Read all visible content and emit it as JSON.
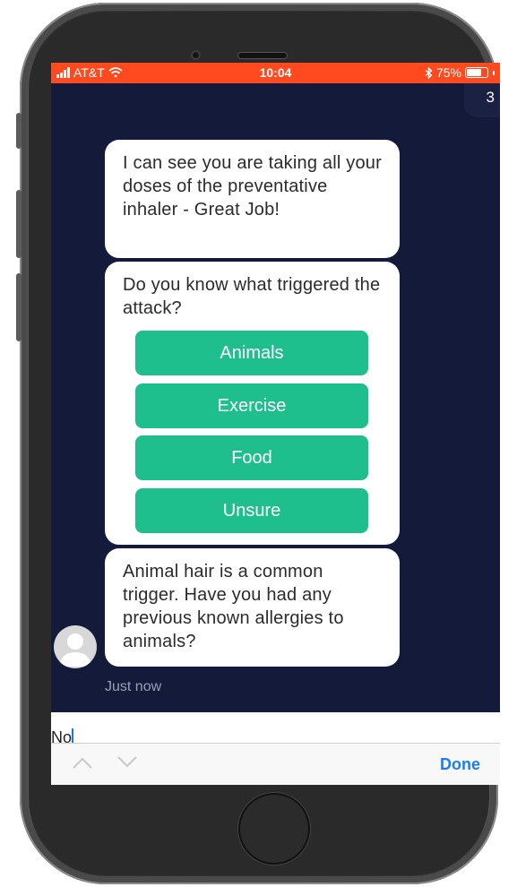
{
  "status_bar": {
    "carrier": "AT&T",
    "time": "10:04",
    "battery": "75%",
    "battery_level": 0.75,
    "background_color": "#ff4a1f"
  },
  "header": {
    "badge_count": "3"
  },
  "chat": {
    "messages": [
      {
        "text": "I can see you are taking all your doses of the preventative inhaler - Great Job!"
      },
      {
        "text": "Do you know what triggered the attack?",
        "options": [
          "Animals",
          "Exercise",
          "Food",
          "Unsure"
        ]
      },
      {
        "text": "Animal hair is a common trigger. Have you had any previous known allergies to animals?"
      }
    ],
    "timestamp": "Just now",
    "option_color": "#1fbf8d",
    "background_color": "#141a3a"
  },
  "composer": {
    "value": "No"
  },
  "keyboard_toolbar": {
    "done_label": "Done",
    "done_color": "#1a7cf5"
  },
  "icons": {
    "signal": "signal-bars-icon",
    "wifi": "wifi-icon",
    "bluetooth": "bluetooth-icon",
    "battery": "battery-icon",
    "avatar": "user-avatar-icon",
    "previous": "chevron-up-icon",
    "next": "chevron-down-icon"
  }
}
